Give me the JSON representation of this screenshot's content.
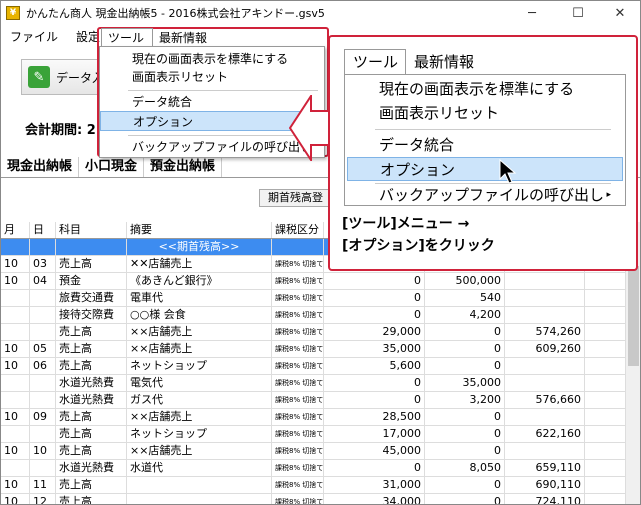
{
  "window": {
    "title": "かんたん商人 現金出納帳5 - 2016株式会社アキンドー.gsv5",
    "minimize": "─",
    "maximize": "☐",
    "close": "✕"
  },
  "menubar": {
    "items": [
      "ファイル",
      "設定",
      "ツール",
      "最新情報"
    ]
  },
  "toolbar": {
    "data_button_label": "データ入"
  },
  "period_label": "会計期間: 2",
  "tabs": [
    "現金出納帳",
    "小口現金",
    "預金出納帳"
  ],
  "opening_balance_button": "期首残高登",
  "table": {
    "headers": [
      "月",
      "日",
      "科目",
      "摘要",
      "課税区分"
    ],
    "rows": [
      {
        "m": "",
        "d": "",
        "acct": "",
        "desc": "<<期首残高>>",
        "tax": "",
        "a": "",
        "b": "",
        "c": "",
        "highlight": true
      },
      {
        "m": "10",
        "d": "03",
        "acct": "売上高",
        "desc": "✕✕店舗売上",
        "tax": "課税8% 切捨て",
        "a": "",
        "b": "",
        "c": ""
      },
      {
        "m": "10",
        "d": "04",
        "acct": "預金",
        "desc": "《あきんど銀行》",
        "tax": "課税8% 切捨て",
        "a": "0",
        "b": "500,000",
        "c": ""
      },
      {
        "m": "",
        "d": "",
        "acct": "旅費交通費",
        "desc": "電車代",
        "tax": "課税8% 切捨て",
        "a": "0",
        "b": "540",
        "c": ""
      },
      {
        "m": "",
        "d": "",
        "acct": "接待交際費",
        "desc": "○○様 会食",
        "tax": "課税8% 切捨て",
        "a": "0",
        "b": "4,200",
        "c": ""
      },
      {
        "m": "",
        "d": "",
        "acct": "売上高",
        "desc": "××店舗売上",
        "tax": "課税8% 切捨て",
        "a": "29,000",
        "b": "0",
        "c": "574,260"
      },
      {
        "m": "10",
        "d": "05",
        "acct": "売上高",
        "desc": "××店舗売上",
        "tax": "課税8% 切捨て",
        "a": "35,000",
        "b": "0",
        "c": "609,260"
      },
      {
        "m": "10",
        "d": "06",
        "acct": "売上高",
        "desc": "ネットショップ",
        "tax": "課税8% 切捨て",
        "a": "5,600",
        "b": "0",
        "c": ""
      },
      {
        "m": "",
        "d": "",
        "acct": "水道光熱費",
        "desc": "電気代",
        "tax": "課税8% 切捨て",
        "a": "0",
        "b": "35,000",
        "c": ""
      },
      {
        "m": "",
        "d": "",
        "acct": "水道光熱費",
        "desc": "ガス代",
        "tax": "課税8% 切捨て",
        "a": "0",
        "b": "3,200",
        "c": "576,660"
      },
      {
        "m": "10",
        "d": "09",
        "acct": "売上高",
        "desc": "××店舗売上",
        "tax": "課税8% 切捨て",
        "a": "28,500",
        "b": "0",
        "c": ""
      },
      {
        "m": "",
        "d": "",
        "acct": "売上高",
        "desc": "ネットショップ",
        "tax": "課税8% 切捨て",
        "a": "17,000",
        "b": "0",
        "c": "622,160"
      },
      {
        "m": "10",
        "d": "10",
        "acct": "売上高",
        "desc": "××店舗売上",
        "tax": "課税8% 切捨て",
        "a": "45,000",
        "b": "0",
        "c": ""
      },
      {
        "m": "",
        "d": "",
        "acct": "水道光熱費",
        "desc": "水道代",
        "tax": "課税8% 切捨て",
        "a": "0",
        "b": "8,050",
        "c": "659,110"
      },
      {
        "m": "10",
        "d": "11",
        "acct": "売上高",
        "desc": "",
        "tax": "課税8% 切捨て",
        "a": "31,000",
        "b": "0",
        "c": "690,110"
      },
      {
        "m": "10",
        "d": "12",
        "acct": "売上高",
        "desc": "",
        "tax": "課税8% 切捨て",
        "a": "34,000",
        "b": "0",
        "c": "724,110"
      }
    ]
  },
  "tool_menu": {
    "tab_label": "ツール",
    "news_label": "最新情報",
    "items": [
      "現在の画面表示を標準にする",
      "画面表示リセット",
      "データ統合",
      "オプション",
      "バックアップファイルの呼び出し"
    ],
    "selected": "オプション",
    "submenu_arrow": "▸"
  },
  "caption": {
    "line1": "[ツール]メニュー →",
    "line2": "[オプション]をクリック"
  },
  "colors": {
    "accent_red": "#d0223a",
    "highlight_blue": "#3d8cf0",
    "menu_select": "#cce4fa"
  }
}
